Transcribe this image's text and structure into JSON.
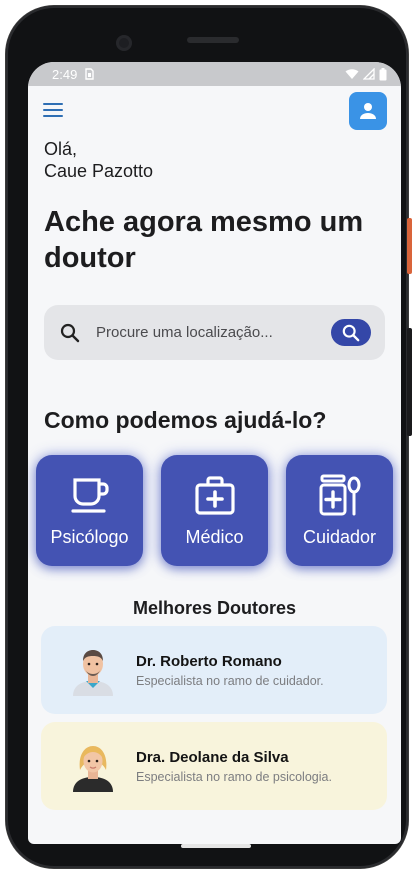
{
  "status_bar": {
    "time": "2:49"
  },
  "greeting": {
    "line1": "Olá,",
    "line2": "Caue Pazotto"
  },
  "headline": "Ache agora mesmo um doutor",
  "search": {
    "placeholder": "Procure uma localização..."
  },
  "help_section": {
    "title": "Como podemos ajudá-lo?"
  },
  "categories": [
    {
      "label": "Psicólogo",
      "icon": "coffee-cup-icon"
    },
    {
      "label": "Médico",
      "icon": "medical-kit-icon"
    },
    {
      "label": "Cuidador",
      "icon": "medicine-spoon-icon"
    }
  ],
  "best_doctors": {
    "title": "Melhores Doutores",
    "items": [
      {
        "name": "Dr. Roberto Romano",
        "specialty": "Especialista no ramo de cuidador.",
        "avatar": "male-doctor-avatar"
      },
      {
        "name": "Dra. Deolane da Silva",
        "specialty": "Especialista no ramo de psicologia.",
        "avatar": "female-doctor-avatar"
      }
    ]
  },
  "colors": {
    "primary": "#4453b3",
    "profile_button": "#3a93e6",
    "card1_bg": "#e3eef9",
    "card2_bg": "#f8f4dc"
  }
}
